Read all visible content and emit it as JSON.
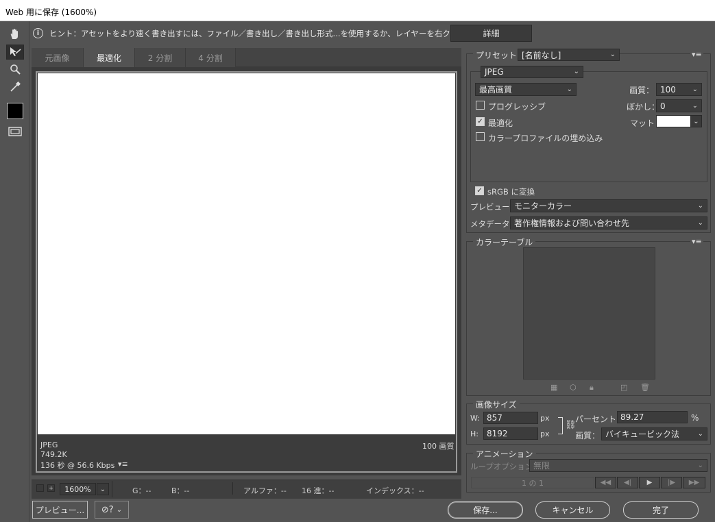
{
  "window": {
    "title": "Web 用に保存 (1600%)"
  },
  "hint": {
    "text": "ヒント：アセットをより速く書き出すには、ファイル／書き出し／書き出し形式...を使用するか、レイヤーを右クリックして使用。",
    "detail_button": "詳細"
  },
  "tabs": [
    {
      "label": "元画像",
      "active": false
    },
    {
      "label": "最適化",
      "active": true
    },
    {
      "label": "2 分割",
      "active": false
    },
    {
      "label": "4 分割",
      "active": false
    }
  ],
  "preview": {
    "format": "JPEG",
    "size": "749.2K",
    "time": "136 秒 @ 56.6 Kbps",
    "quality_label": "100 画質"
  },
  "status": {
    "zoom": "1600%",
    "g": "G：--",
    "b": "B：--",
    "alpha": "アルファ：--",
    "hex": "16 進：--",
    "index": "インデックス：--"
  },
  "buttons": {
    "preview": "プレビュー...",
    "save": "保存...",
    "cancel": "キャンセル",
    "done": "完了"
  },
  "preset": {
    "label": "プリセット：",
    "value": "[名前なし]"
  },
  "settings": {
    "format": "JPEG",
    "quality_preset": "最高画質",
    "quality_label": "画質：",
    "quality_value": "100",
    "progressive_label": "プログレッシブ",
    "progressive_checked": false,
    "blur_label": "ぼかし：",
    "blur_value": "0",
    "optimize_label": "最適化",
    "optimize_checked": true,
    "matte_label": "マット：",
    "embed_profile_label": "カラープロファイルの埋め込み",
    "embed_profile_checked": false,
    "srgb_label": "sRGB に変換",
    "srgb_checked": true,
    "preview_label": "プレビュー：",
    "preview_value": "モニターカラー",
    "metadata_label": "メタデータ：",
    "metadata_value": "著作権情報および問い合わせ先"
  },
  "color_table": {
    "title": "カラーテーブル"
  },
  "image_size": {
    "title": "画像サイズ",
    "w_label": "W:",
    "w_value": "857",
    "h_label": "H:",
    "h_value": "8192",
    "unit": "px",
    "percent_label": "パーセント：",
    "percent_value": "89.27",
    "percent_unit": "%",
    "quality_label": "画質：",
    "quality_value": "バイキュービック法"
  },
  "animation": {
    "title": "アニメーション",
    "loop_label": "ループオプション：",
    "loop_value": "無限",
    "frame_counter": "1 の 1"
  },
  "colors": {
    "matte": "#ffffff",
    "bg": "#535353"
  }
}
